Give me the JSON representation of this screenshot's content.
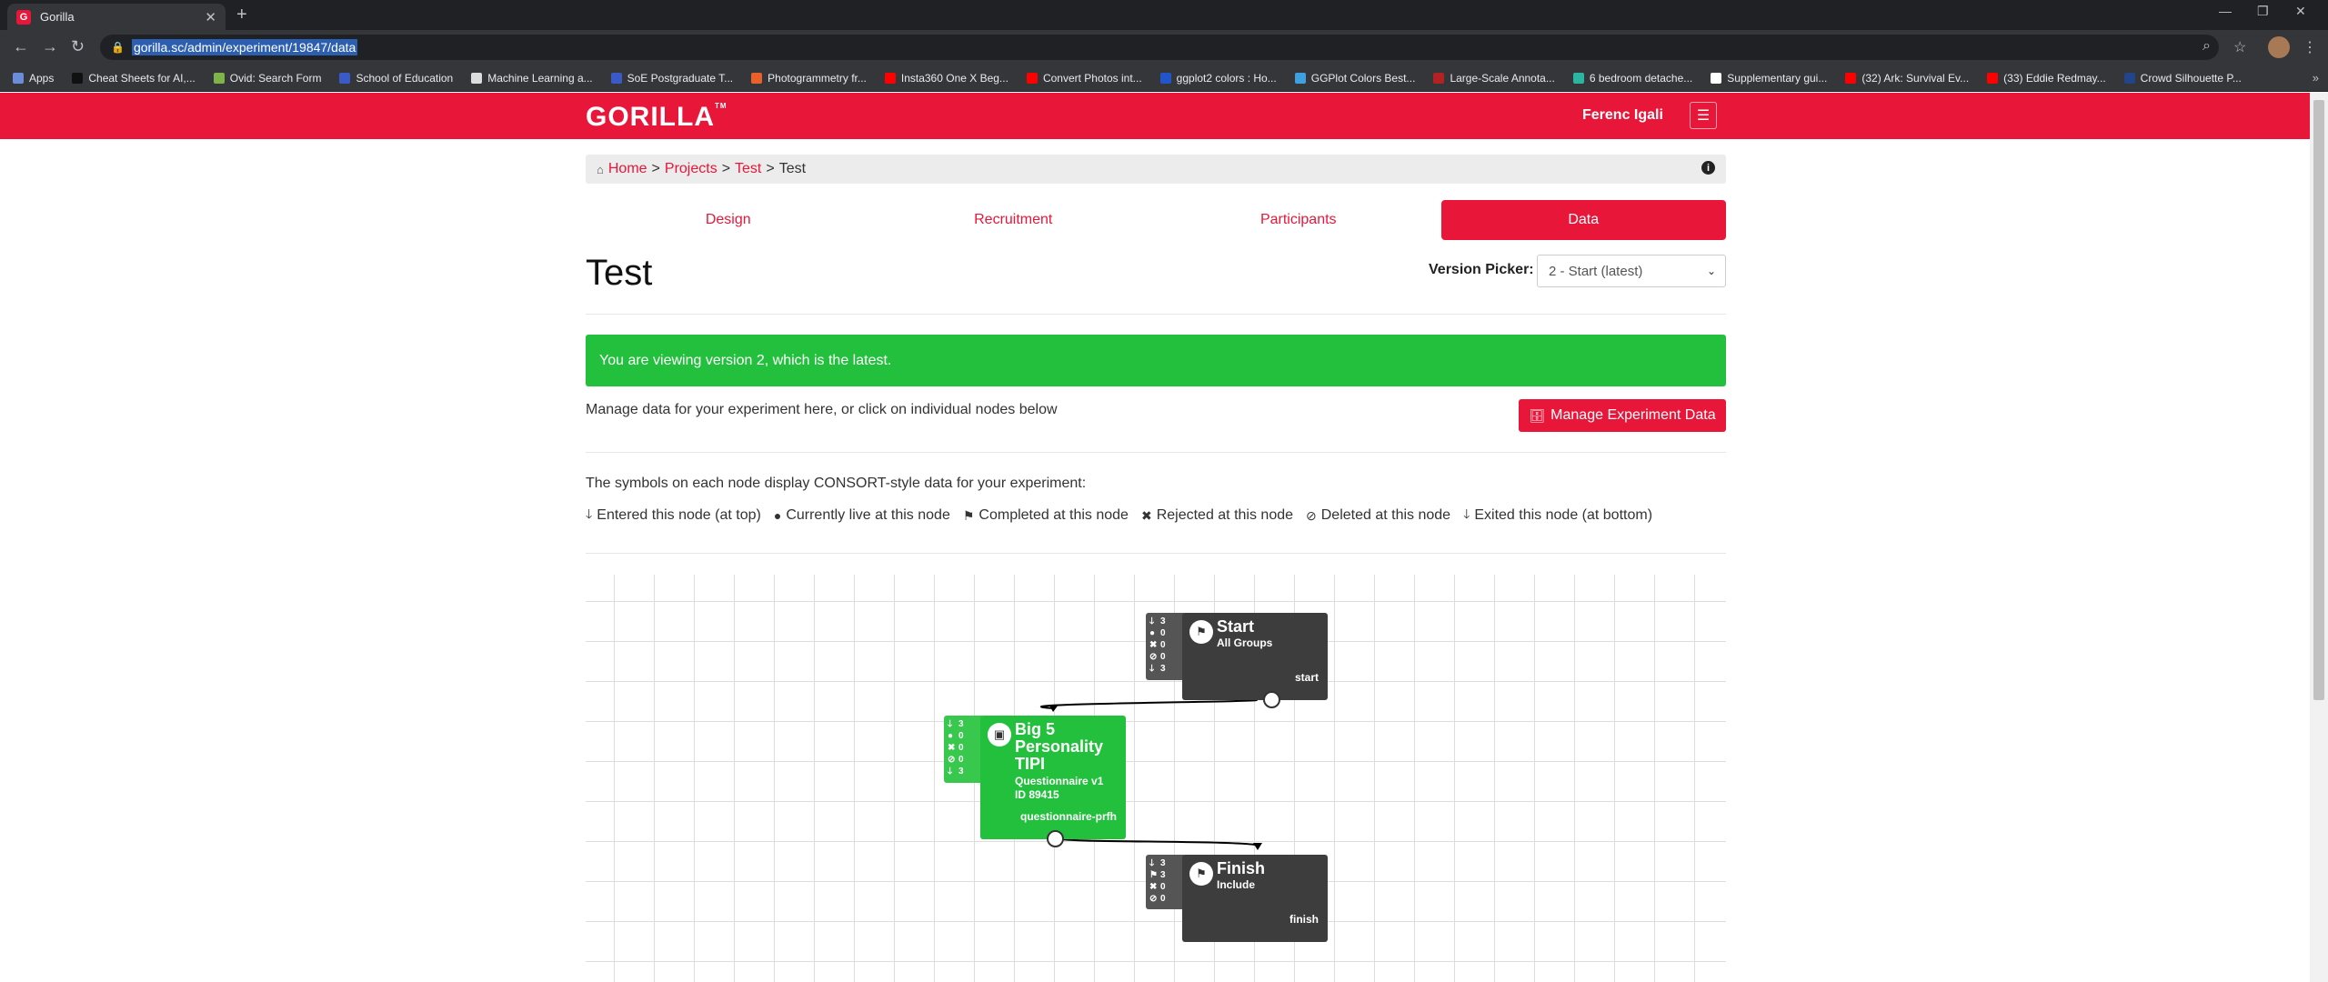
{
  "browser": {
    "tab_title": "Gorilla",
    "tab_favicon": "G",
    "url": "gorilla.sc/admin/experiment/19847/data",
    "bookmarks": [
      {
        "label": "Apps",
        "color": "#6b8cd6"
      },
      {
        "label": "Cheat Sheets for AI,...",
        "color": "#111111"
      },
      {
        "label": "Ovid: Search Form",
        "color": "#7eb34a"
      },
      {
        "label": "School of Education",
        "color": "#3a5bc7"
      },
      {
        "label": "Machine Learning a...",
        "color": "#dddddd"
      },
      {
        "label": "SoE Postgraduate T...",
        "color": "#3a5bc7"
      },
      {
        "label": "Photogrammetry fr...",
        "color": "#e8602c"
      },
      {
        "label": "Insta360 One X Beg...",
        "color": "#ff0000"
      },
      {
        "label": "Convert Photos int...",
        "color": "#ff0000"
      },
      {
        "label": "ggplot2 colors : Ho...",
        "color": "#2255cc"
      },
      {
        "label": "GGPlot Colors Best...",
        "color": "#3fa0e0"
      },
      {
        "label": "Large-Scale Annota...",
        "color": "#b22222"
      },
      {
        "label": "6 bedroom detache...",
        "color": "#2bb5a0"
      },
      {
        "label": "Supplementary gui...",
        "color": "#ffffff"
      },
      {
        "label": "(32) Ark: Survival Ev...",
        "color": "#ff0000"
      },
      {
        "label": "(33) Eddie Redmay...",
        "color": "#ff0000"
      },
      {
        "label": "Crowd Silhouette P...",
        "color": "#224488"
      }
    ]
  },
  "header": {
    "logo": "GORILLA",
    "logo_tm": "TM",
    "user": "Ferenc Igali"
  },
  "breadcrumb": {
    "home": "Home",
    "projects": "Projects",
    "test_link": "Test",
    "current": "Test"
  },
  "tabs": [
    "Design",
    "Recruitment",
    "Participants",
    "Data"
  ],
  "page": {
    "title": "Test",
    "version_label": "Version Picker:",
    "version_value": "2 - Start (latest)",
    "alert": "You are viewing version 2, which is the latest.",
    "manage_text": "Manage data for your experiment here, or click on individual nodes below",
    "manage_button": "Manage Experiment Data",
    "symbols_text": "The symbols on each node display CONSORT-style data for your experiment:",
    "legend": [
      {
        "sym": "🡓",
        "label": "Entered this node (at top)"
      },
      {
        "sym": "●",
        "label": "Currently live at this node"
      },
      {
        "sym": "⚑",
        "label": "Completed at this node"
      },
      {
        "sym": "✖",
        "label": "Rejected at this node"
      },
      {
        "sym": "⊘",
        "label": "Deleted at this node"
      },
      {
        "sym": "🡓",
        "label": "Exited this node (at bottom)"
      }
    ]
  },
  "nodes": {
    "start": {
      "title": "Start",
      "sub": "All Groups",
      "id": "start",
      "stats": [
        {
          "sym": "🡓",
          "val": "3"
        },
        {
          "sym": "●",
          "val": "0"
        },
        {
          "sym": "✖",
          "val": "0"
        },
        {
          "sym": "⊘",
          "val": "0"
        },
        {
          "sym": "🡓",
          "val": "3"
        }
      ],
      "color": "#3d3d3d"
    },
    "questionnaire": {
      "title_1": "Big 5",
      "title_2": "Personality",
      "title_3": "TIPI",
      "sub_1": "Questionnaire v1",
      "sub_2": "ID 89415",
      "id": "questionnaire-prfh",
      "stats": [
        {
          "sym": "🡓",
          "val": "3"
        },
        {
          "sym": "●",
          "val": "0"
        },
        {
          "sym": "✖",
          "val": "0"
        },
        {
          "sym": "⊘",
          "val": "0"
        },
        {
          "sym": "🡓",
          "val": "3"
        }
      ],
      "color": "#23c03d"
    },
    "finish": {
      "title": "Finish",
      "sub": "Include",
      "id": "finish",
      "stats": [
        {
          "sym": "🡓",
          "val": "3"
        },
        {
          "sym": "⚑",
          "val": "3"
        },
        {
          "sym": "✖",
          "val": "0"
        },
        {
          "sym": "⊘",
          "val": "0"
        }
      ],
      "color": "#3d3d3d"
    }
  },
  "colors": {
    "brand": "#e8173a",
    "success": "#23c03d",
    "node_dark": "#3d3d3d"
  }
}
